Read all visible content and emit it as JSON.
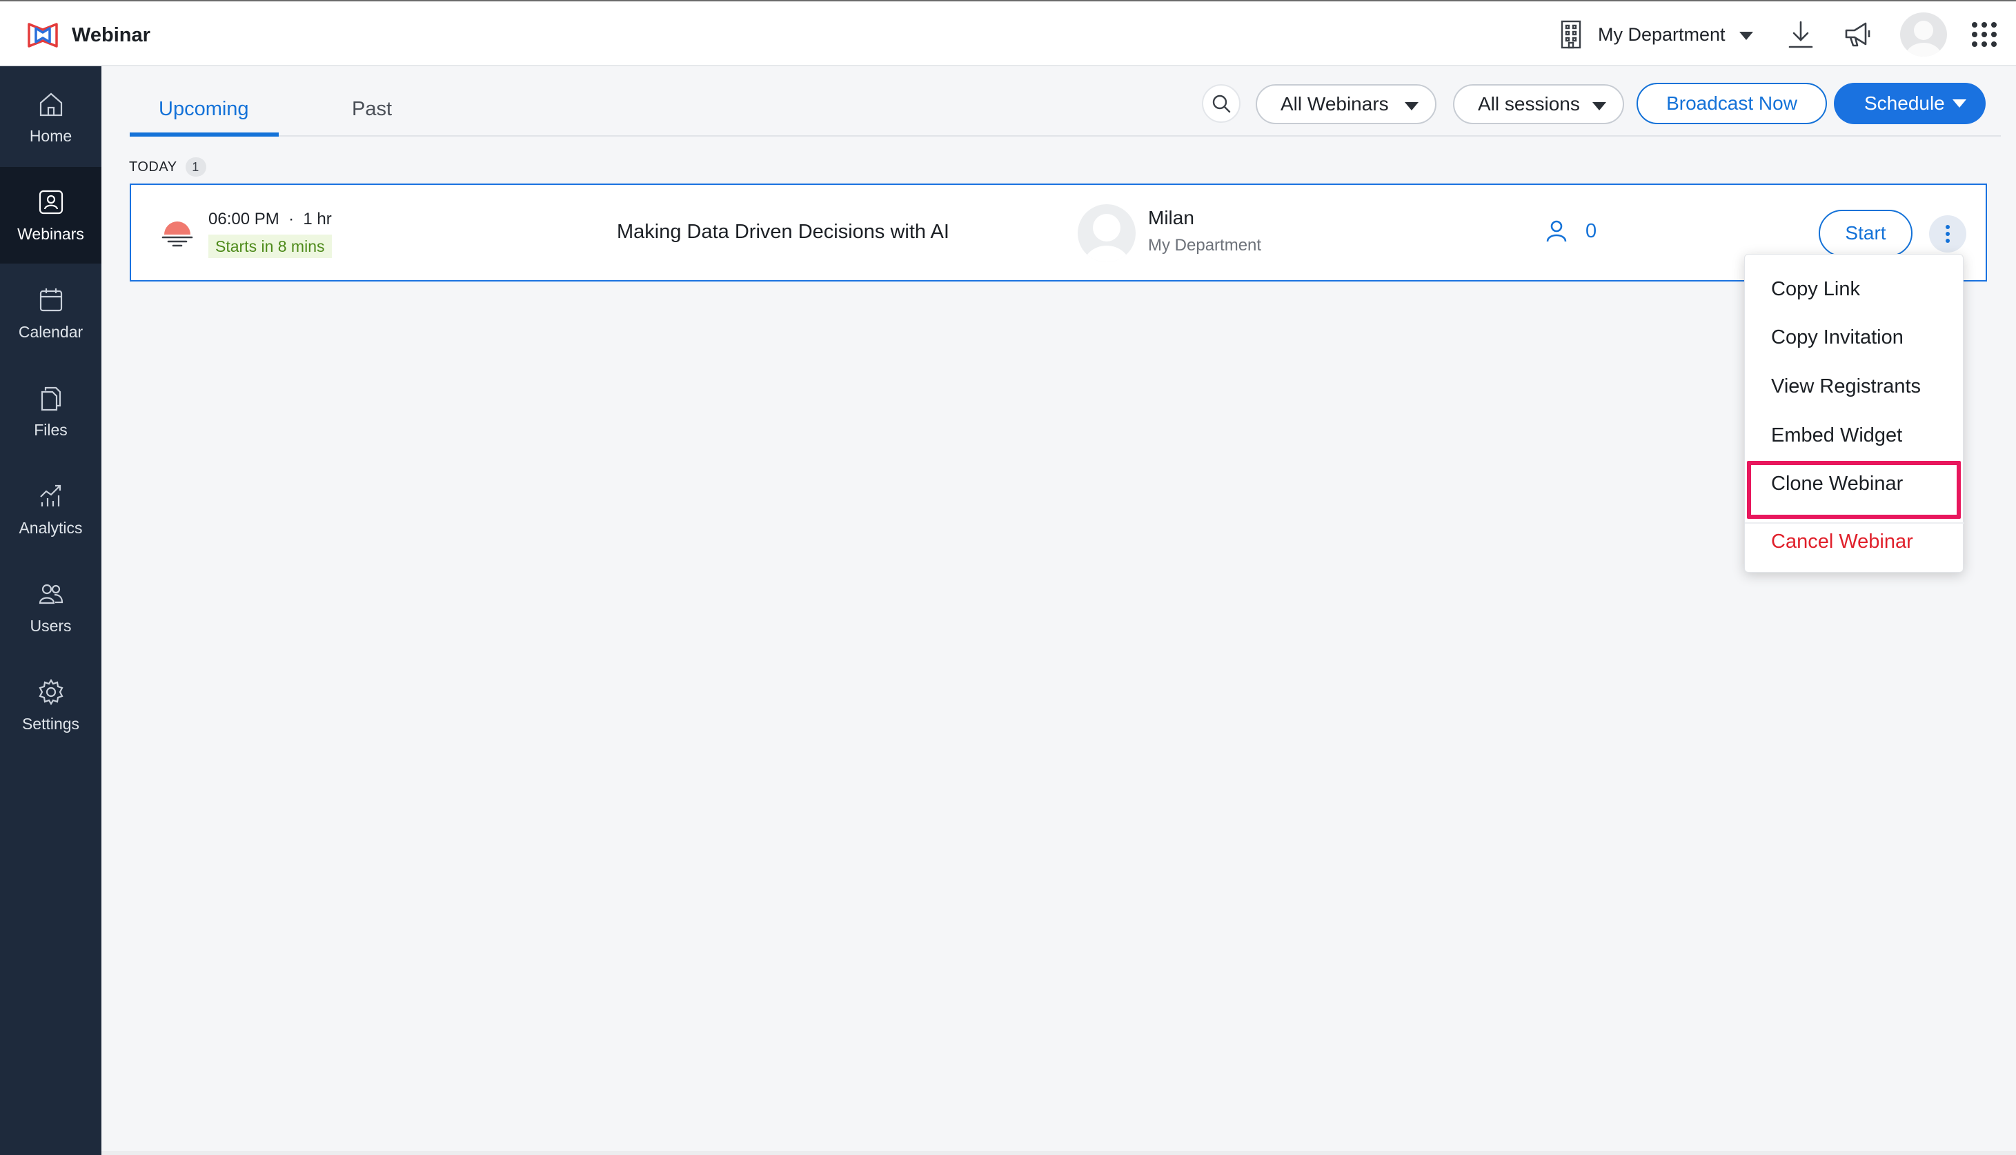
{
  "header": {
    "app_title": "Webinar",
    "department": "My Department",
    "icons": [
      "webinar-logo-icon",
      "building-icon",
      "download-icon",
      "megaphone-icon",
      "avatar",
      "grid-apps-icon"
    ]
  },
  "sidebar": {
    "items": [
      {
        "label": "Home",
        "icon": "home-icon"
      },
      {
        "label": "Webinars",
        "icon": "webinar-icon",
        "active": true
      },
      {
        "label": "Calendar",
        "icon": "calendar-icon"
      },
      {
        "label": "Files",
        "icon": "files-icon"
      },
      {
        "label": "Analytics",
        "icon": "analytics-icon"
      },
      {
        "label": "Users",
        "icon": "users-icon"
      },
      {
        "label": "Settings",
        "icon": "gear-icon"
      }
    ]
  },
  "tabs": [
    {
      "label": "Upcoming",
      "active": true
    },
    {
      "label": "Past",
      "active": false
    }
  ],
  "toolbar": {
    "filter_webinars": "All Webinars",
    "filter_sessions": "All sessions",
    "broadcast_label": "Broadcast Now",
    "schedule_label": "Schedule"
  },
  "section": {
    "label": "TODAY",
    "count": "1"
  },
  "webinar": {
    "time": "06:00 PM  ·  1 hr",
    "starts_in": "Starts in 8 mins",
    "title": "Making Data Driven Decisions with AI",
    "host_name": "Milan",
    "host_department": "My Department",
    "registrants": "0",
    "start_label": "Start"
  },
  "context_menu": {
    "items": [
      "Copy Link",
      "Copy Invitation",
      "View Registrants",
      "Embed Widget",
      "Clone Webinar"
    ],
    "danger_item": "Cancel Webinar",
    "highlighted": "Clone Webinar"
  },
  "colors": {
    "accent": "#1472d8",
    "sidebar_bg": "#1e2a3c",
    "danger": "#e0202b",
    "highlight": "#e8175d"
  }
}
